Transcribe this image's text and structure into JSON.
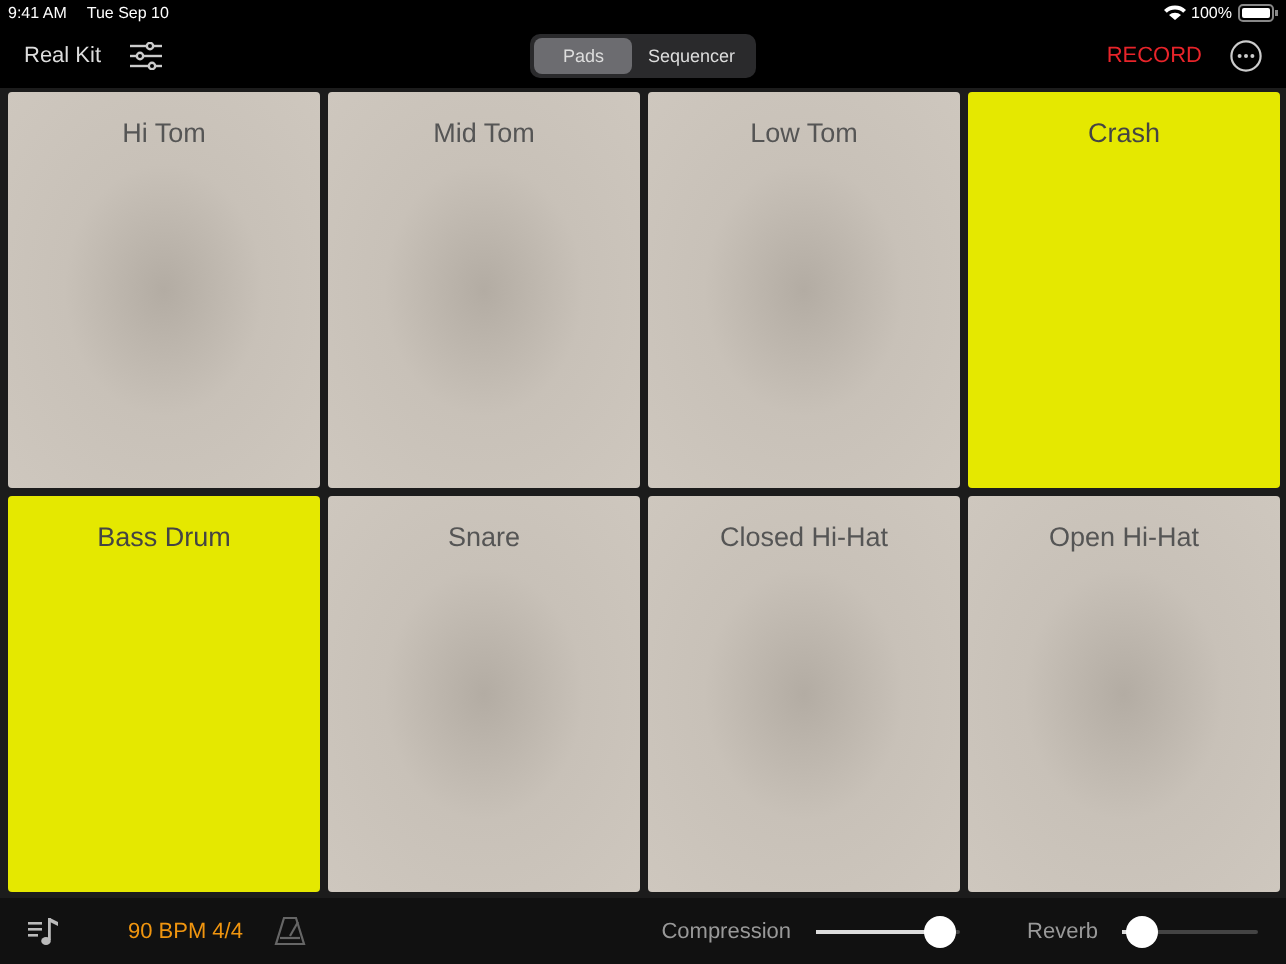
{
  "status_bar": {
    "time": "9:41 AM",
    "date": "Tue Sep 10",
    "battery": "100%"
  },
  "toolbar": {
    "title": "Real Kit",
    "tabs": [
      {
        "label": "Pads",
        "selected": true
      },
      {
        "label": "Sequencer",
        "selected": false
      }
    ],
    "record": "RECORD"
  },
  "pads": [
    {
      "label": "Hi Tom",
      "active": false
    },
    {
      "label": "Mid Tom",
      "active": false
    },
    {
      "label": "Low Tom",
      "active": false
    },
    {
      "label": "Crash",
      "active": true
    },
    {
      "label": "Bass Drum",
      "active": true
    },
    {
      "label": "Snare",
      "active": false
    },
    {
      "label": "Closed Hi-Hat",
      "active": false
    },
    {
      "label": "Open Hi-Hat",
      "active": false
    }
  ],
  "bottom_bar": {
    "tempo": "90 BPM 4/4",
    "sliders": [
      {
        "label": "Compression",
        "level": 0.87
      },
      {
        "label": "Reverb",
        "level": 0.15
      }
    ]
  }
}
